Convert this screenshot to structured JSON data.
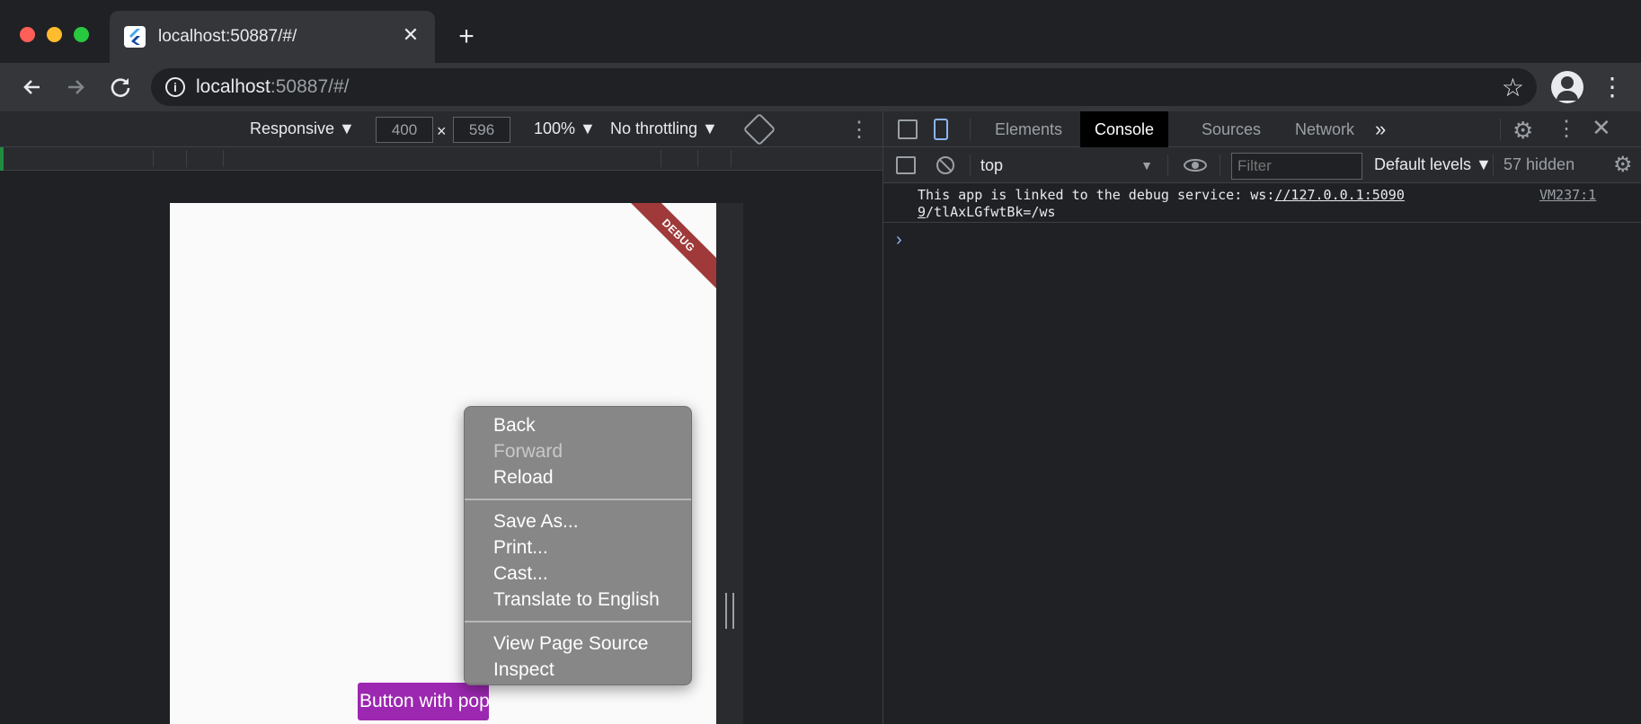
{
  "browser": {
    "tab_title": "localhost:50887/#/",
    "tab_close": "✕",
    "new_tab": "+",
    "url_host": "localhost",
    "url_rest": ":50887/#/"
  },
  "device_toolbar": {
    "responsive": "Responsive ▼",
    "width": "400",
    "times": "×",
    "height": "596",
    "zoom": "100% ▼",
    "throttling": "No throttling ▼",
    "more": "⋮"
  },
  "app": {
    "debug_banner": "DEBUG",
    "purple_button": "Button with popup menu"
  },
  "context_menu": {
    "items": [
      {
        "label": "Back",
        "enabled": true
      },
      {
        "label": "Forward",
        "enabled": false
      },
      {
        "label": "Reload",
        "enabled": true
      },
      {
        "label": "Save As...",
        "enabled": true
      },
      {
        "label": "Print...",
        "enabled": true
      },
      {
        "label": "Cast...",
        "enabled": true
      },
      {
        "label": "Translate to English",
        "enabled": true
      },
      {
        "label": "View Page Source",
        "enabled": true
      },
      {
        "label": "Inspect",
        "enabled": true
      }
    ]
  },
  "devtools": {
    "tabs": [
      "Elements",
      "Console",
      "Sources",
      "Network"
    ],
    "active_tab": "Console",
    "more_tabs": "»",
    "context": "top",
    "filter_placeholder": "Filter",
    "levels": "Default levels ▼",
    "hidden": "57 hidden",
    "message_prefix": "This app is linked to the debug service: ws:",
    "message_link1": "//127.0.0.1:5090",
    "message_link2": "9",
    "message_suffix": "/tlAxLGfwtBk=/ws",
    "message_source": "VM237:1",
    "prompt": "›"
  },
  "icons": {
    "back": "arrow-left-icon",
    "forward": "arrow-right-icon",
    "reload": "reload-icon",
    "star": "star-icon",
    "gear": "gear-icon"
  },
  "colors": {
    "accent_purple": "#9c27b0",
    "debug_ribbon": "#a03a3a",
    "devtools_blue": "#8ab4f8"
  }
}
